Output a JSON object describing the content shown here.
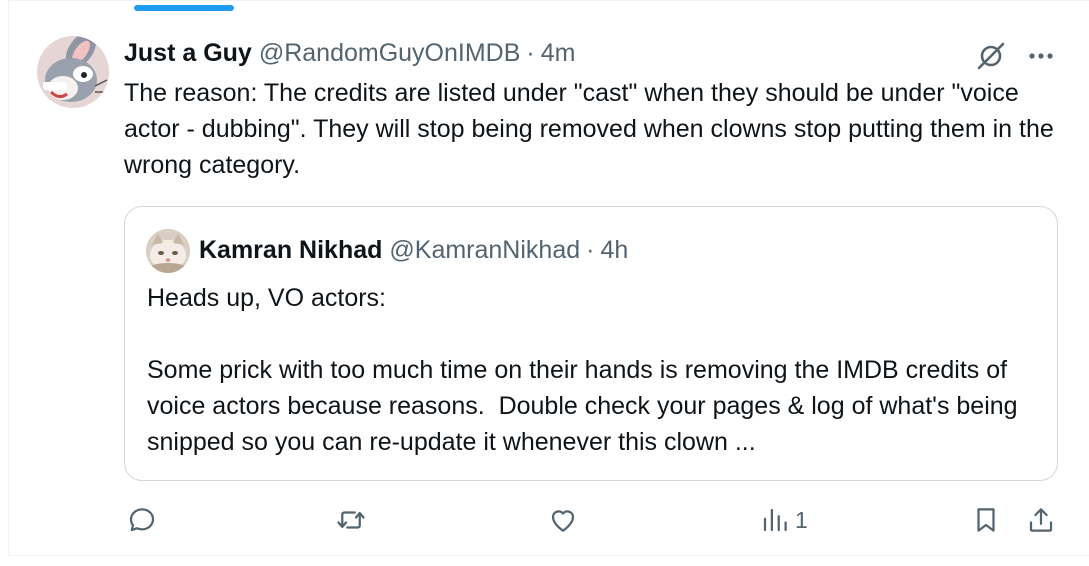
{
  "colors": {
    "accent": "#1d9bf0",
    "text_primary": "#0f1419",
    "text_secondary": "#536471",
    "border": "#cfd9de"
  },
  "tweet": {
    "author": {
      "display_name": "Just a Guy",
      "handle": "@RandomGuyOnIMDB",
      "separator": "·",
      "timestamp": "4m",
      "avatar_icon": "cartoon-rabbit-avatar"
    },
    "text": "The reason: The credits are listed under \"cast\" when they should be under \"voice actor - dubbing\". They will stop being removed when clowns stop putting them in the wrong category.",
    "header_icons": [
      "grok-icon",
      "more-icon"
    ]
  },
  "quote": {
    "author": {
      "display_name": "Kamran Nikhad",
      "handle": "@KamranNikhad",
      "separator": "·",
      "timestamp": "4h",
      "avatar_icon": "cat-avatar"
    },
    "text": "Heads up, VO actors:\n\nSome prick with too much time on their hands is removing the IMDB credits of voice actors because reasons.  Double check your pages & log of what's being snipped so you can re-update it whenever this clown ..."
  },
  "actions": {
    "reply": {
      "icon": "reply-icon"
    },
    "repost": {
      "icon": "repost-icon"
    },
    "like": {
      "icon": "like-icon"
    },
    "views": {
      "icon": "views-icon",
      "count": "1"
    },
    "bookmark": {
      "icon": "bookmark-icon"
    },
    "share": {
      "icon": "share-icon"
    }
  }
}
